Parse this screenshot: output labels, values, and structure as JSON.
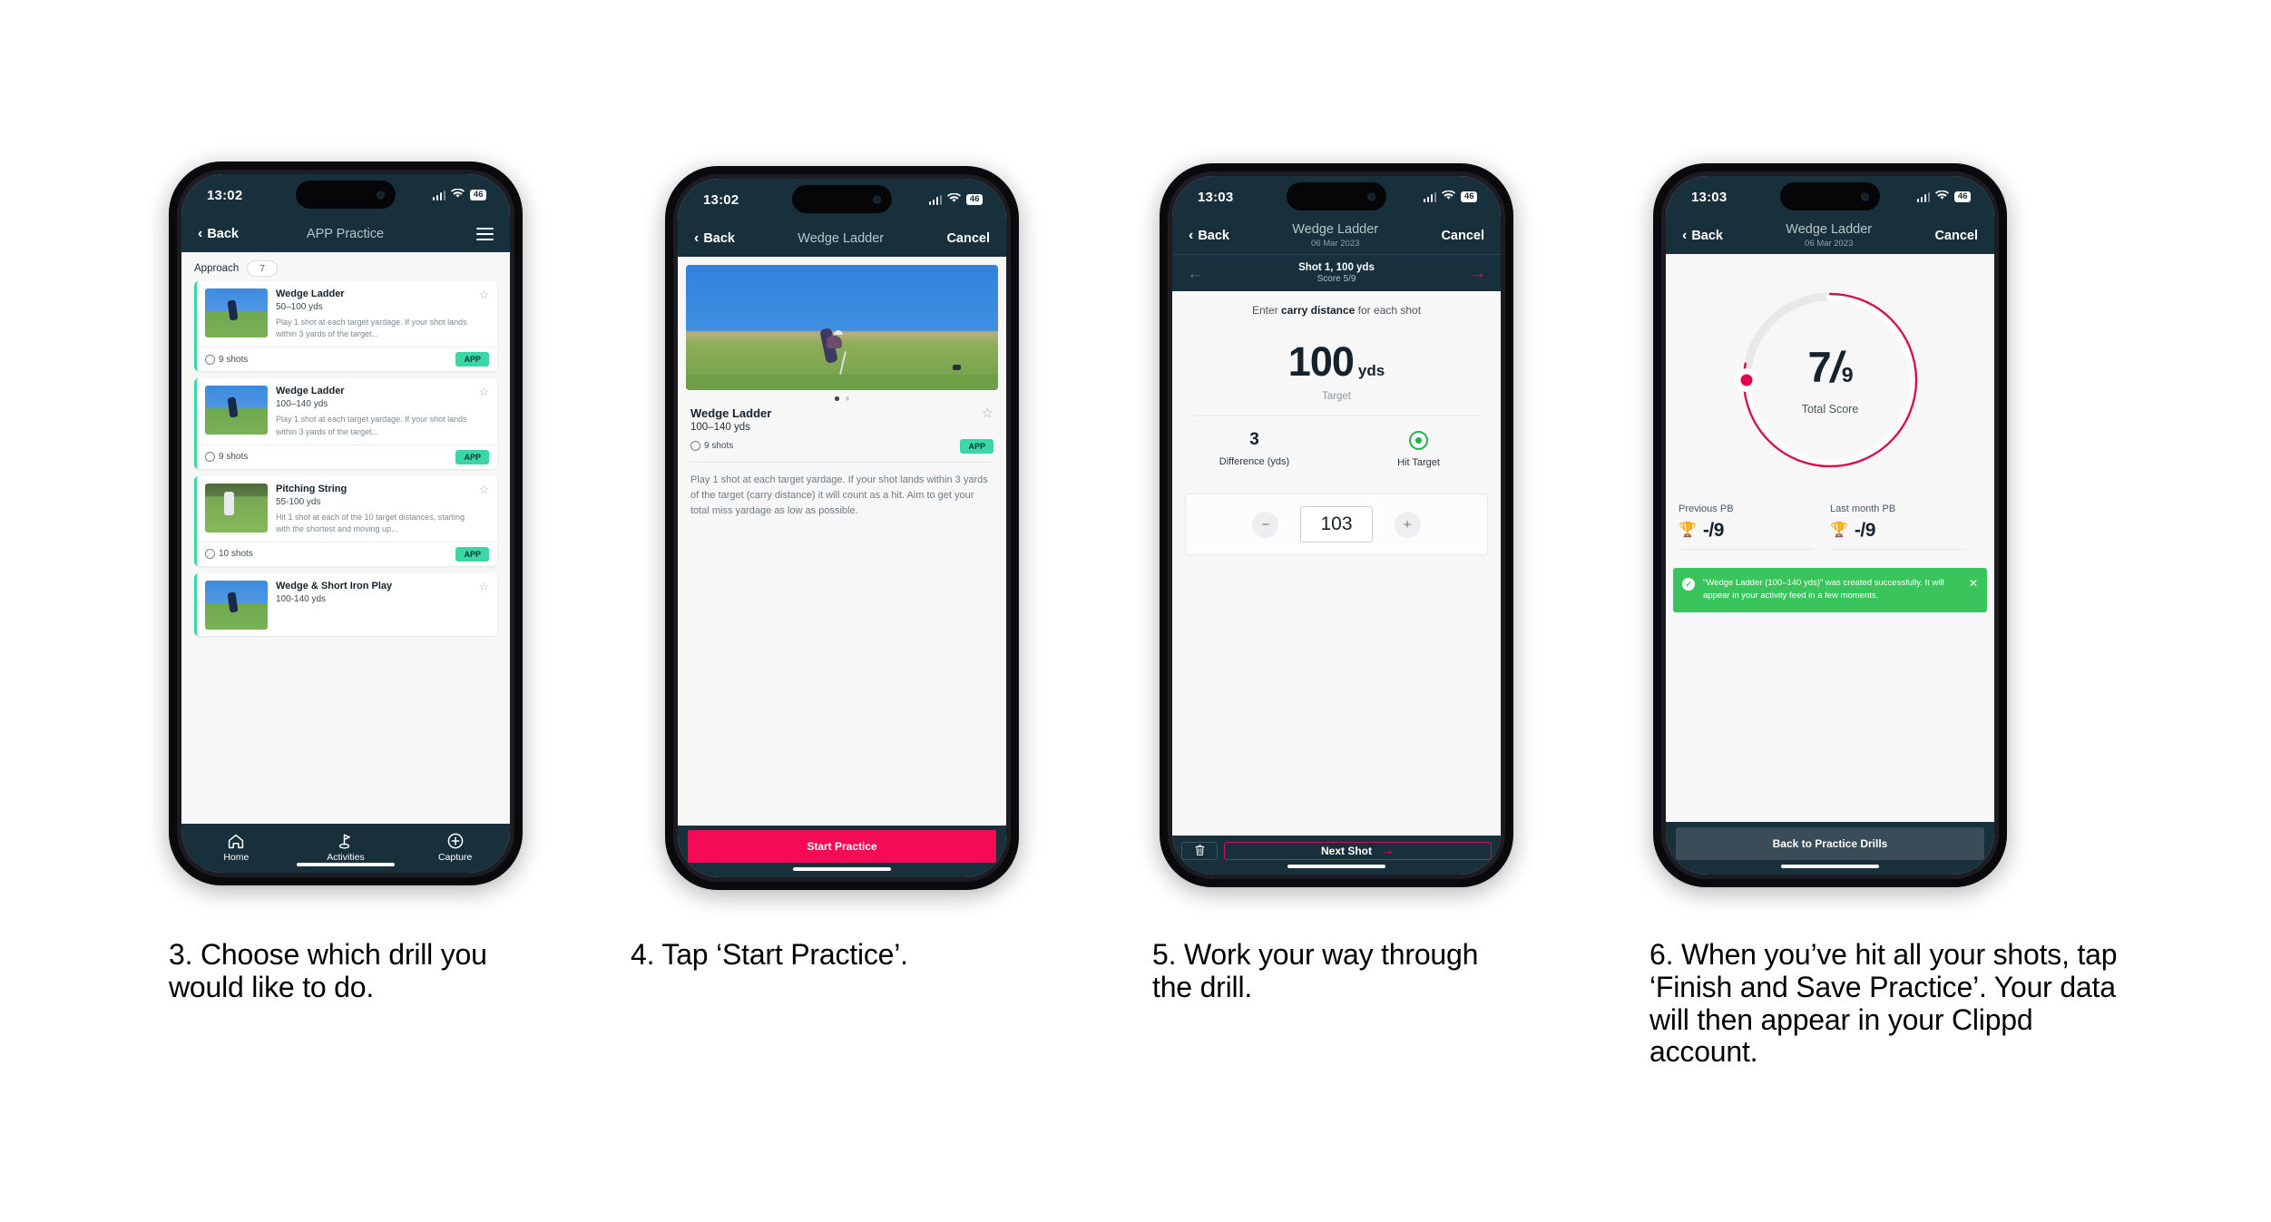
{
  "colors": {
    "nav_dark": "#17303c",
    "accent_pink": "#f50a55",
    "accent_teal": "#3ad6a5",
    "toast_green": "#3ac45c",
    "hit_green": "#22b24c"
  },
  "screens": [
    {
      "id": "app-practice-list",
      "status": {
        "time": "13:02",
        "battery": "46"
      },
      "nav": {
        "back": "Back",
        "title": "APP Practice",
        "menu_icon": "hamburger-icon"
      },
      "filter": {
        "label": "Approach",
        "count": "7"
      },
      "drills": [
        {
          "title": "Wedge Ladder",
          "range": "50–100 yds",
          "desc": "Play 1 shot at each target yardage. If your shot lands within 3 yards of the target...",
          "shots": "9 shots",
          "badge": "APP"
        },
        {
          "title": "Wedge Ladder",
          "range": "100–140 yds",
          "desc": "Play 1 shot at each target yardage. If your shot lands within 3 yards of the target...",
          "shots": "9 shots",
          "badge": "APP"
        },
        {
          "title": "Pitching String",
          "range": "55-100 yds",
          "desc": "Hit 1 shot at each of the 10 target distances, starting with the shortest and moving up...",
          "shots": "10 shots",
          "badge": "APP"
        },
        {
          "title": "Wedge & Short Iron Play",
          "range": "100-140 yds",
          "desc": "",
          "shots": "",
          "badge": ""
        }
      ],
      "tabs": [
        {
          "label": "Home",
          "icon": "home-icon"
        },
        {
          "label": "Activities",
          "icon": "golf-flag-icon"
        },
        {
          "label": "Capture",
          "icon": "plus-circle-icon"
        }
      ]
    },
    {
      "id": "drill-detail",
      "status": {
        "time": "13:02",
        "battery": "46"
      },
      "nav": {
        "back": "Back",
        "title": "Wedge Ladder",
        "cancel": "Cancel"
      },
      "detail": {
        "title": "Wedge Ladder",
        "range": "100–140 yds",
        "shots": "9 shots",
        "badge": "APP",
        "description": "Play 1 shot at each target yardage. If your shot lands within 3 yards of the target (carry distance) it will count as a hit. Aim to get your total miss yardage as low as possible."
      },
      "cta": "Start Practice"
    },
    {
      "id": "shot-entry",
      "status": {
        "time": "13:03",
        "battery": "46"
      },
      "nav": {
        "back": "Back",
        "title": "Wedge Ladder",
        "subtitle": "06 Mar 2023",
        "cancel": "Cancel"
      },
      "shot_header": {
        "title": "Shot 1, 100 yds",
        "score": "Score 5/9"
      },
      "prompt_pre": "Enter ",
      "prompt_bold": "carry distance",
      "prompt_post": " for each shot",
      "target": {
        "value": "100",
        "unit": "yds",
        "label": "Target"
      },
      "stats": [
        {
          "value": "3",
          "label": "Difference (yds)"
        },
        {
          "value": "hit-target-icon",
          "label": "Hit Target"
        }
      ],
      "stepper": {
        "minus": "−",
        "value": "103",
        "plus": "+"
      },
      "footer": {
        "delete_icon": "trash-icon",
        "next": "Next Shot",
        "next_arrow": "→"
      }
    },
    {
      "id": "summary",
      "status": {
        "time": "13:03",
        "battery": "46"
      },
      "nav": {
        "back": "Back",
        "title": "Wedge Ladder",
        "subtitle": "06 Mar 2023",
        "cancel": "Cancel"
      },
      "ring": {
        "numerator": "7",
        "slash": "/",
        "denominator": "9",
        "label": "Total Score",
        "percent": 78
      },
      "pbs": [
        {
          "label": "Previous PB",
          "value": "-/9",
          "icon": "trophy-icon"
        },
        {
          "label": "Last month PB",
          "value": "-/9",
          "icon": "trophy-icon"
        }
      ],
      "toast": {
        "message": "\"Wedge Ladder (100–140 yds)\" was created successfully. It will appear in your activity feed in a few moments.",
        "check_icon": "check-icon",
        "close_icon": "close-icon"
      },
      "footer_button": "Back to Practice Drills"
    }
  ],
  "captions": [
    "3. Choose which drill you would like to do.",
    "4. Tap ‘Start Practice’.",
    "5. Work your way through the drill.",
    "6. When you’ve hit all your shots, tap ‘Finish and Save Practice’. Your data will then appear in your Clippd account."
  ]
}
